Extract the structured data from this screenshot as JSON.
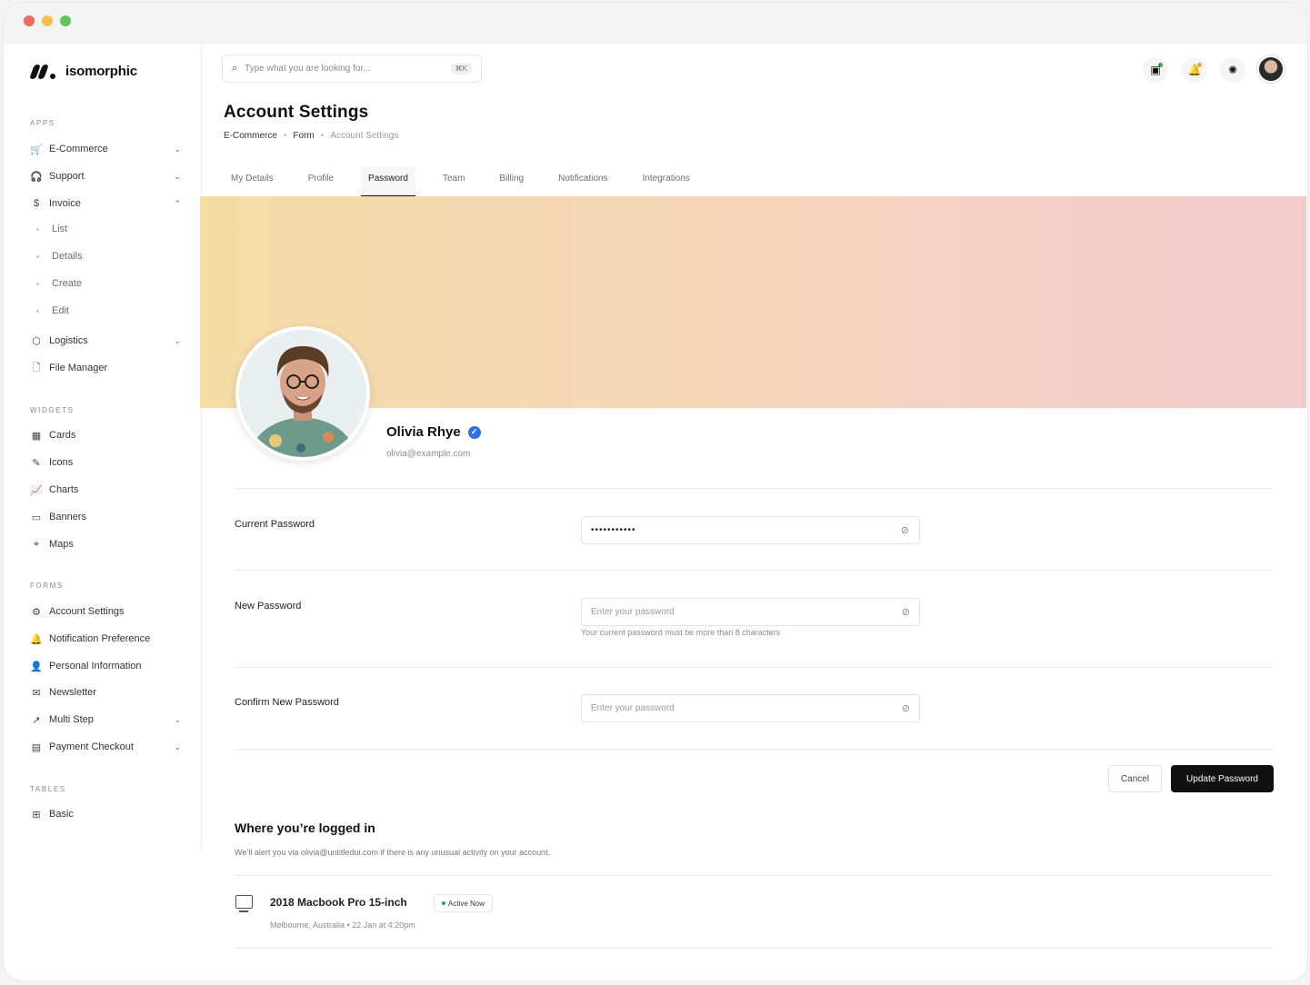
{
  "brand": {
    "name": "isomorphic"
  },
  "sidebar": {
    "sections": {
      "apps": "APPS",
      "widgets": "WIDGETS",
      "forms": "FORMS",
      "tables": "TABLES"
    },
    "apps": [
      {
        "label": "E-Commerce",
        "icon": "cart-icon",
        "chevron": "down"
      },
      {
        "label": "Support",
        "icon": "headset-icon",
        "chevron": "down"
      },
      {
        "label": "Invoice",
        "icon": "dollar-icon",
        "chevron": "up"
      }
    ],
    "invoice_sub": [
      "List",
      "Details",
      "Create",
      "Edit"
    ],
    "apps_more": [
      {
        "label": "Logistics",
        "icon": "package-icon",
        "chevron": "down"
      },
      {
        "label": "File Manager",
        "icon": "file-icon"
      }
    ],
    "widgets": [
      {
        "label": "Cards",
        "icon": "grid-icon"
      },
      {
        "label": "Icons",
        "icon": "feather-icon"
      },
      {
        "label": "Charts",
        "icon": "chart-icon"
      },
      {
        "label": "Banners",
        "icon": "banner-icon"
      },
      {
        "label": "Maps",
        "icon": "map-pin-icon"
      }
    ],
    "forms": [
      {
        "label": "Account Settings",
        "icon": "user-cog-icon"
      },
      {
        "label": "Notification Preference",
        "icon": "bell-icon"
      },
      {
        "label": "Personal Information",
        "icon": "user-icon"
      },
      {
        "label": "Newsletter",
        "icon": "mail-icon"
      },
      {
        "label": "Multi Step",
        "icon": "steps-icon",
        "chevron": "down"
      },
      {
        "label": "Payment Checkout",
        "icon": "credit-card-icon",
        "chevron": "down"
      }
    ],
    "tables": [
      {
        "label": "Basic",
        "icon": "table-icon"
      }
    ]
  },
  "search": {
    "placeholder": "Type what you are looking for...",
    "shortcut": "⌘K"
  },
  "page": {
    "title": "Account Settings",
    "breadcrumb": [
      "E-Commerce",
      "Form",
      "Account Settings"
    ]
  },
  "tabs": [
    "My Details",
    "Profile",
    "Password",
    "Team",
    "Billing",
    "Notifications",
    "Integrations"
  ],
  "active_tab": "Password",
  "profile": {
    "name": "Olivia Rhye",
    "email": "olivia@example.com"
  },
  "password_form": {
    "current": {
      "label": "Current Password",
      "value": "•••••••••••"
    },
    "new": {
      "label": "New Password",
      "placeholder": "Enter your password",
      "hint": "Your current password must be more than 8 characters"
    },
    "confirm": {
      "label": "Confirm New Password",
      "placeholder": "Enter your password"
    },
    "cancel_label": "Cancel",
    "submit_label": "Update Password"
  },
  "sessions": {
    "title": "Where you’re logged in",
    "description": "We’ll alert you via olivia@untitledui.com if there is any unusual activity on your account.",
    "device": {
      "name": "2018 Macbook Pro 15-inch",
      "status": "Active Now",
      "location": "Melbourne, Australia",
      "time": "22 Jan at 4:20pm"
    }
  },
  "colors": {
    "accent": "#111111",
    "verified": "#2f6fe8",
    "active": "#2ea44f",
    "banner_start": "#f5dca6",
    "banner_end": "#f2cccc"
  }
}
